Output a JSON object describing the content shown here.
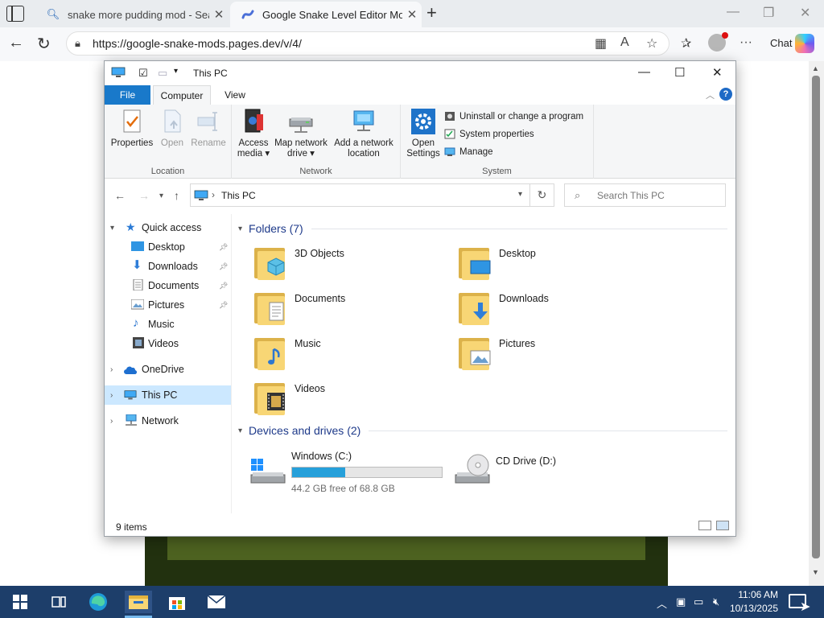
{
  "browser": {
    "tabs": [
      {
        "title": "snake more pudding mod - Searc",
        "icon": "search-icon"
      },
      {
        "title": "Google Snake Level Editor Mod",
        "icon": "snake-mod-icon"
      }
    ],
    "url": "https://google-snake-mods.pages.dev/v/4/",
    "chat_label": "Chat"
  },
  "explorer": {
    "title": "This PC",
    "ribbon_tabs": [
      "File",
      "Computer",
      "View"
    ],
    "location_group": {
      "label": "Location",
      "buttons": [
        "Properties",
        "Open",
        "Rename"
      ]
    },
    "network_group": {
      "label": "Network",
      "buttons": [
        "Access media",
        "Map network drive",
        "Add a network location"
      ],
      "access_media_l1": "Access",
      "access_media_l2": "media",
      "map_drive_l1": "Map network",
      "map_drive_l2": "drive",
      "add_loc_l1": "Add a network",
      "add_loc_l2": "location"
    },
    "system_group": {
      "label": "System",
      "open_settings_l1": "Open",
      "open_settings_l2": "Settings",
      "items": [
        "Uninstall or change a program",
        "System properties",
        "Manage"
      ]
    },
    "address": "This PC",
    "search_placeholder": "Search This PC",
    "nav": {
      "quick_access": "Quick access",
      "quick_items": [
        "Desktop",
        "Downloads",
        "Documents",
        "Pictures",
        "Music",
        "Videos"
      ],
      "onedrive": "OneDrive",
      "this_pc": "This PC",
      "network": "Network"
    },
    "folders_header": "Folders (7)",
    "folders": [
      "3D Objects",
      "Desktop",
      "Documents",
      "Downloads",
      "Music",
      "Pictures",
      "Videos"
    ],
    "drives_header": "Devices and drives (2)",
    "drives": [
      {
        "name": "Windows (C:)",
        "free": "44.2 GB free of 68.8 GB",
        "used_fraction": 0.357
      },
      {
        "name": "CD Drive (D:)"
      }
    ],
    "status_items": "9 items"
  },
  "taskbar": {
    "time": "11:06 AM",
    "date": "10/13/2025"
  }
}
